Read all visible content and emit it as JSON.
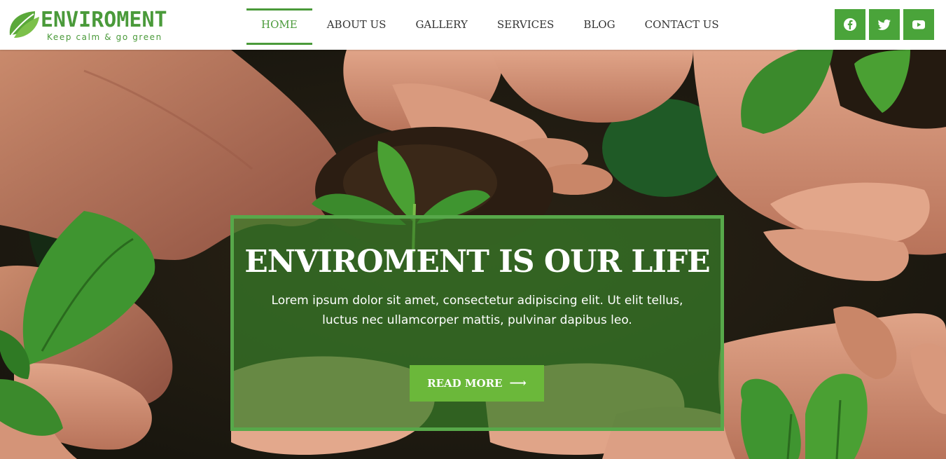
{
  "brand": {
    "name": "ENVIROMENT",
    "tagline": "Keep calm & go green",
    "color": "#4a9a3a"
  },
  "nav": {
    "items": [
      {
        "label": "HOME",
        "active": true
      },
      {
        "label": "ABOUT US",
        "active": false
      },
      {
        "label": "GALLERY",
        "active": false
      },
      {
        "label": "SERVICES",
        "active": false
      },
      {
        "label": "BLOG",
        "active": false
      },
      {
        "label": "CONTACT US",
        "active": false
      }
    ]
  },
  "social": {
    "icons": [
      "facebook-icon",
      "twitter-icon",
      "youtube-icon"
    ],
    "color": "#4aa43a"
  },
  "hero": {
    "headline": "ENVIROMENT IS OUR LIFE",
    "subtext": "Lorem ipsum dolor sit amet, consectetur adipiscing elit. Ut elit tellus, luctus nec ullamcorper mattis, pulvinar dapibus leo.",
    "cta_label": "READ MORE",
    "cta_icon": "arrow-right-icon",
    "overlay_color": "#377d28",
    "cta_color": "#6bb83a"
  }
}
